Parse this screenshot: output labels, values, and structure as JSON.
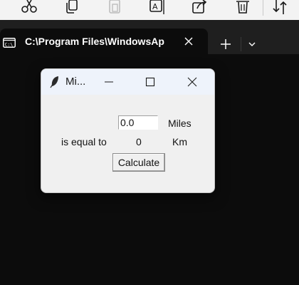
{
  "explorer_toolbar": {
    "icons": [
      "cut-icon",
      "copy-icon",
      "paste-icon",
      "rename-icon",
      "share-icon",
      "delete-icon",
      "sort-icon"
    ]
  },
  "terminal": {
    "tab_title": "C:\\Program Files\\WindowsAp",
    "icons": [
      "console-icon",
      "close-icon",
      "plus-icon",
      "chevron-down-icon"
    ]
  },
  "app_window": {
    "title": "Mi...",
    "icons": [
      "feather-icon",
      "minimize-icon",
      "maximize-icon",
      "close-icon"
    ],
    "miles_value": "0.0",
    "miles_label": "Miles",
    "is_equal_to_label": "is equal to",
    "result_value": "0",
    "km_label": "Km",
    "calculate_label": "Calculate"
  }
}
